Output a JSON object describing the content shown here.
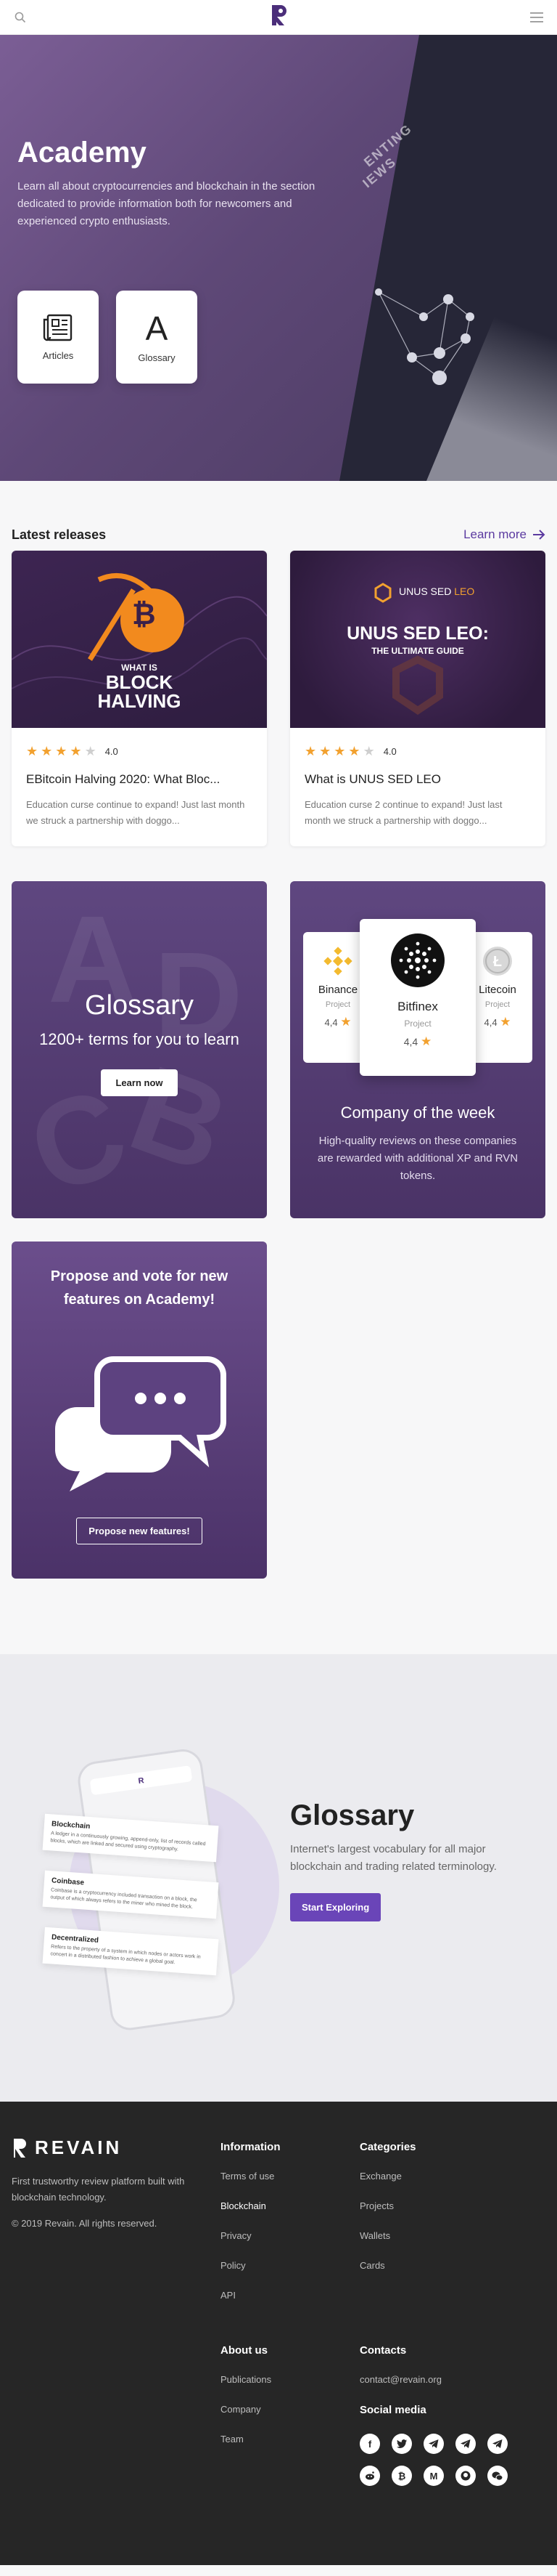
{
  "header": {
    "search_icon": "search-icon",
    "logo_letter": "R",
    "menu_icon": "menu-icon"
  },
  "hero": {
    "title": "Academy",
    "description": "Learn all about cryptocurrencies and blockchain in the section dedicated to provide information both for newcomers and experienced crypto enthusiasts.",
    "book_text_line1": "ENTING",
    "book_text_line2": "IEWS",
    "tiles": [
      {
        "label": "Articles",
        "icon": "newspaper-icon"
      },
      {
        "label": "Glossary",
        "glyph": "A"
      }
    ]
  },
  "latest": {
    "title": "Latest releases",
    "learn_more": "Learn more",
    "cards": [
      {
        "image_title_line1": "WHAT IS",
        "image_title_line2": "BLOCK",
        "image_title_line3": "HALVING",
        "stars": 4,
        "rating": "4.0",
        "title": "EBitcoin Halving 2020: What Bloc...",
        "desc": "Education curse continue to expand! Just last month we struck a partnership with doggo..."
      },
      {
        "image_brand": "UNUS SED",
        "image_brand_accent": "LEO",
        "image_title_line1": "UNUS SED LEO:",
        "image_title_line2": "THE ULTIMATE GUIDE",
        "stars": 4,
        "rating": "4.0",
        "title": "What is UNUS SED LEO",
        "desc": "Education curse 2 continue to expand! Just last month we struck a partnership with doggo..."
      }
    ]
  },
  "glossary_promo": {
    "title": "Glossary",
    "subtitle": "1200+ terms for you to learn",
    "button": "Learn now",
    "letters": [
      "A",
      "B",
      "C",
      "D"
    ]
  },
  "company": {
    "title": "Company of the week",
    "desc": "High-quality reviews on these companies are rewarded with additional XP and RVN tokens.",
    "items": [
      {
        "name": "Binance",
        "type": "Project",
        "rating": "4,4"
      },
      {
        "name": "Bitfinex",
        "type": "Project",
        "rating": "4,4"
      },
      {
        "name": "Litecoin",
        "type": "Project",
        "rating": "4,4"
      }
    ]
  },
  "propose": {
    "title": "Propose and vote for new features on Academy!",
    "button": "Propose new features!"
  },
  "glossary_section": {
    "title": "Glossary",
    "desc": "Internet's largest vocabulary for all major blockchain and trading related terminology.",
    "button": "Start Exploring",
    "phone_cards": [
      {
        "term": "Blockchain",
        "text": "A ledger in a continuously growing, append-only, list of records called blocks, which are linked and secured using cryptography."
      },
      {
        "term": "Coinbase",
        "text": "Coinbase is a cryptocurrency included transaction on a block, the output of which always refers to the miner who mined the block."
      },
      {
        "term": "Decentralized",
        "text": "Refers to the property of a system in which nodes or actors work in concert in a distributed fashion to achieve a global goal."
      }
    ]
  },
  "footer": {
    "brand": "REVAIN",
    "about": "First trustworthy review platform built with blockchain technology.",
    "copyright": "© 2019 Revain. All rights reserved.",
    "information": {
      "title": "Information",
      "items": [
        "Terms of use",
        "Blockchain",
        "Privacy",
        "Policy",
        "API"
      ]
    },
    "categories": {
      "title": "Categories",
      "items": [
        "Exchange",
        "Projects",
        "Wallets",
        "Cards"
      ]
    },
    "about_us": {
      "title": "About us",
      "items": [
        "Publications",
        "Company",
        "Team"
      ]
    },
    "contacts": {
      "title": "Contacts",
      "email": "contact@revain.org"
    },
    "social": {
      "title": "Social media",
      "icons": [
        "facebook-icon",
        "twitter-icon",
        "telegram-icon",
        "telegram-icon",
        "telegram-icon",
        "reddit-icon",
        "bitcointalk-icon",
        "medium-icon",
        "github-icon",
        "wechat-icon"
      ]
    }
  }
}
